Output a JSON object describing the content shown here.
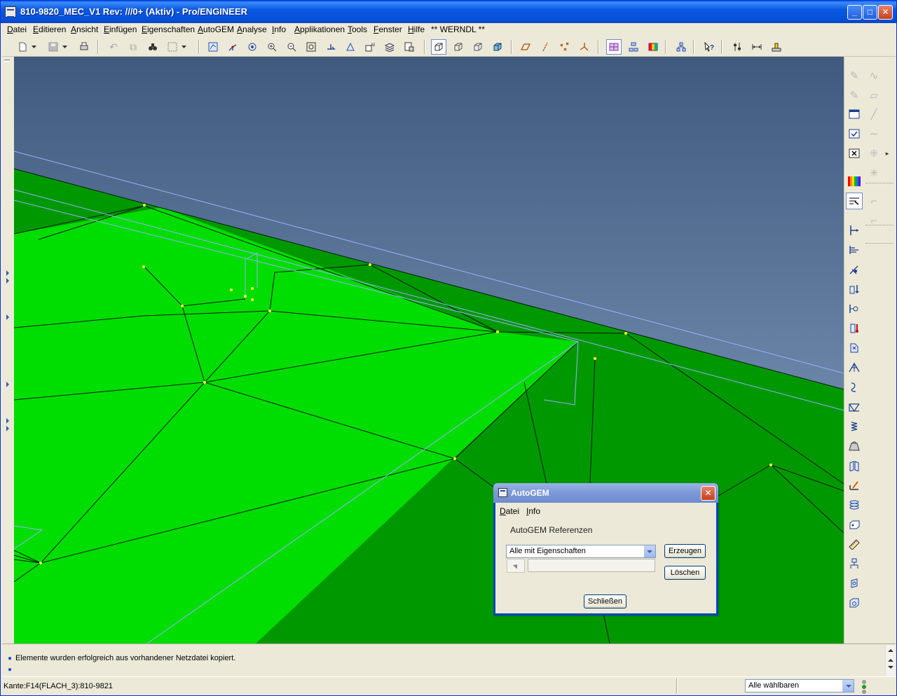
{
  "window": {
    "title": "810-9820_MEC_V1 Rev: ///0+ (Aktiv) - Pro/ENGINEER",
    "minimize_glyph": "_",
    "maximize_glyph": "□",
    "close_glyph": "✕"
  },
  "menubar": {
    "items": [
      "Datei",
      "Editieren",
      "Ansicht",
      "Einfügen",
      "Eigenschaften",
      "AutoGEM",
      "Analyse",
      "Info",
      "Applikationen",
      "Tools",
      "Fenster",
      "Hilfe",
      "** WERNDL **"
    ]
  },
  "viewport": {
    "background_top": "#3f5a7e",
    "background_bottom": "#8aa6c6",
    "surface_light": "#00dd00",
    "surface_dark": "#009800",
    "mesh_color": "#0a1a0a",
    "edge_color": "#9ab0ff",
    "node_color": "#ffff40"
  },
  "messages": {
    "lines": [
      "Elemente wurden erfolgreich aus vorhandener Netzdatei kopiert.",
      ""
    ]
  },
  "statusbar": {
    "text": "Kante:F14(FLACH_3):810-9821",
    "filter_value": "Alle wählbaren"
  },
  "autogem_dialog": {
    "title": "AutoGEM",
    "close_glyph": "✕",
    "menu": [
      "Datei",
      "Info"
    ],
    "group_label": "AutoGEM Referenzen",
    "combo_value": "Alle mit Eigenschaften",
    "create_button": "Erzeugen",
    "delete_button": "Löschen",
    "close_button": "Schließen"
  }
}
